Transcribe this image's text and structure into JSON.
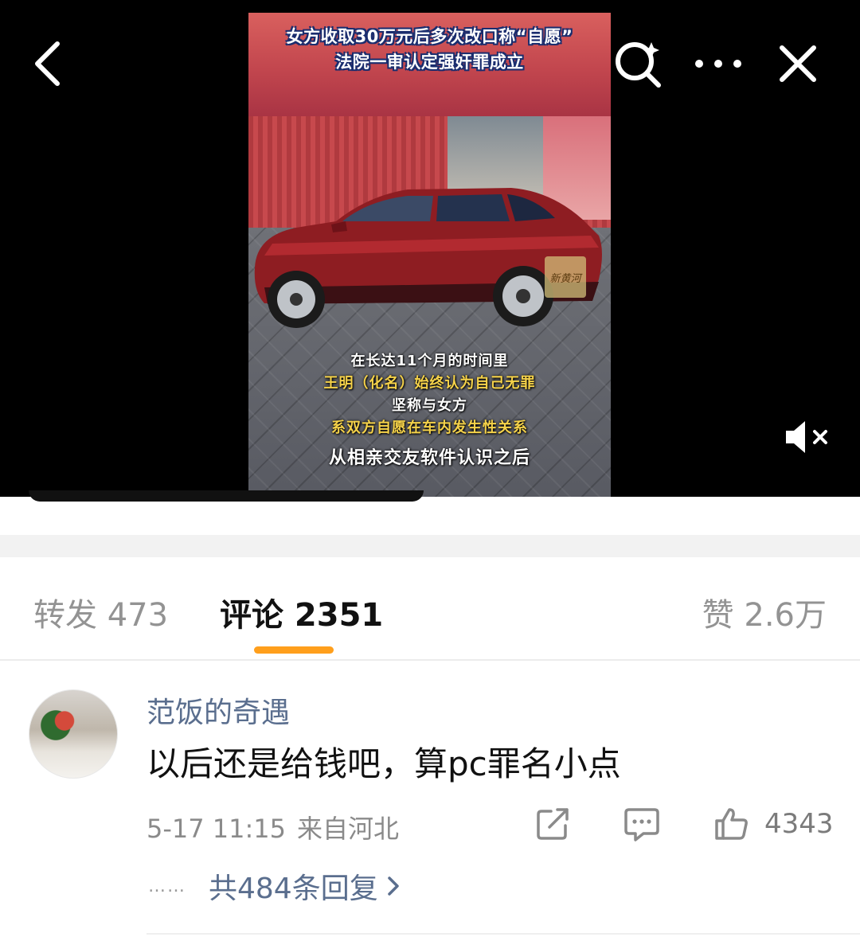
{
  "video": {
    "headline_line1": "女方收取30万元后多次改口称“自愿”",
    "headline_line2": "法院一审认定强奸罪成立",
    "subtitles": [
      "在长达11个月的时间里",
      "王明（化名）始终认为自己无罪",
      "坚称与女方",
      "系双方自愿在车内发生性关系",
      "从相亲交友软件认识之后"
    ],
    "watermark": "新黄河",
    "colors": {
      "headline_text": "#ffffff",
      "headline_outline": "#1a2d6e",
      "subtitle_yellow": "#f5d24a"
    }
  },
  "toolbar": {
    "back_icon": "chevron-left-icon",
    "search_icon": "search-sparkle-icon",
    "more_icon": "more-dots-icon",
    "close_icon": "close-icon",
    "mute_icon": "speaker-muted-icon"
  },
  "tabs": {
    "repost": "转发 473",
    "comment": "评论 2351",
    "like": "赞 2.6万",
    "active": "comment",
    "active_color": "#ff9f1c"
  },
  "comment": {
    "username": "范饭的奇遇",
    "text": "以后还是给钱吧，算pc罪名小点",
    "time": "5-17 11:15",
    "location": "来自河北",
    "like_count": "4343",
    "replies_dots": "……",
    "replies_label": "共484条回复",
    "link_color": "#5a6e8e"
  }
}
